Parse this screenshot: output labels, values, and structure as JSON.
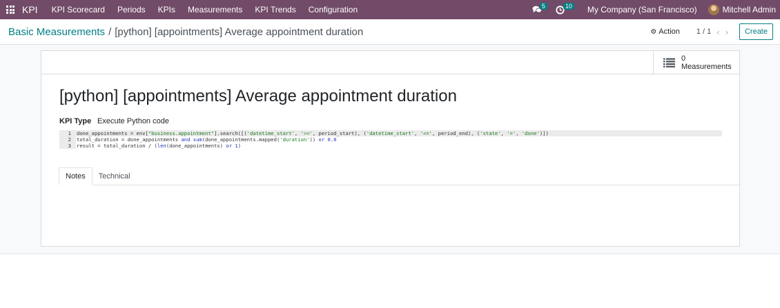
{
  "topbar": {
    "brand": "KPI",
    "menu": [
      "KPI Scorecard",
      "Periods",
      "KPIs",
      "Measurements",
      "KPI Trends",
      "Configuration"
    ],
    "messages_count": "5",
    "activities_count": "10",
    "company": "My Company (San Francisco)",
    "user": "Mitchell Admin"
  },
  "control": {
    "breadcrumb_parent": "Basic Measurements",
    "breadcrumb_separator": "/",
    "breadcrumb_current": "[python] [appointments] Average appointment duration",
    "action_label": "Action",
    "pager": "1 / 1",
    "create_label": "Create"
  },
  "form": {
    "stat_count": "0",
    "stat_label": "Measurements",
    "title": "[python] [appointments] Average appointment duration",
    "kpi_type_label": "KPI Type",
    "kpi_type_value": "Execute Python code",
    "code_line_numbers": [
      "1",
      "2",
      "3"
    ],
    "code_lines": [
      "done_appointments = env[\"business.appointment\"].search([('datetime_start', '>=', period_start), ('datetime_start', '<=', period_end), ('state', '=', 'done')])",
      "total_duration = done_appointments and sum(done_appointments.mapped('duration')) or 0.0",
      "result = total_duration / (len(done_appointments) or 1)"
    ],
    "tabs": [
      "Notes",
      "Technical"
    ]
  },
  "colors": {
    "topbar": "#714b67",
    "accent": "#017e84"
  }
}
